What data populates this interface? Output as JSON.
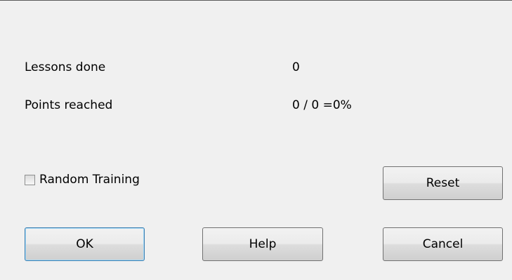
{
  "stats": {
    "lessons_done_label": "Lessons done",
    "lessons_done_value": "0",
    "points_reached_label": "Points reached",
    "points_reached_value": "0 / 0 =0%"
  },
  "options": {
    "random_training_label": "Random Training",
    "random_training_checked": false
  },
  "buttons": {
    "reset": "Reset",
    "ok": "OK",
    "help": "Help",
    "cancel": "Cancel"
  },
  "colors": {
    "dialog_background": "#f0f0f0",
    "default_button_border": "#3c7fb1"
  }
}
